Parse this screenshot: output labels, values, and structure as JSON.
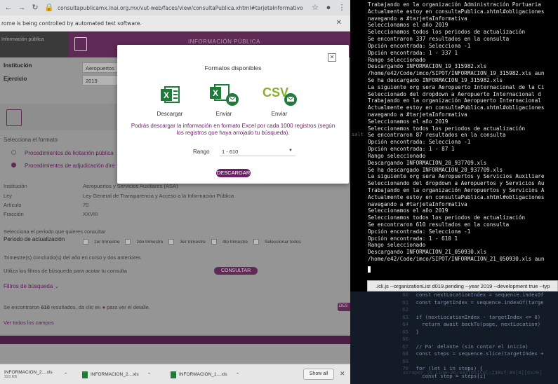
{
  "browser": {
    "url": "consultapublicamx.inai.org.mx/vut-web/faces/view/consultaPublica.xhtml#tarjetaInformativo",
    "automation_banner": "rome is being controlled by automated test software.",
    "header": {
      "logo_alt": "Información pública",
      "title": "INFORMACIÓN PÚBLICA"
    },
    "institucion_label": "Institución",
    "institucion_value": "Aeropuertos",
    "ejercicio_label": "Ejercicio",
    "ejercicio_value": "2019",
    "select_format_label": "Selecciona el formato",
    "radio_options": [
      "Procedimientos de licitación pública",
      "Procedimientos de adjudicación dire"
    ],
    "info_rows": [
      {
        "label": "Institución",
        "value": "Aeropuertos y Servicios Auxiliares (ASA)"
      },
      {
        "label": "Ley",
        "value": "Ley General de Transparencia y Acceso a la Información Pública"
      },
      {
        "label": "Artículo",
        "value": "70"
      },
      {
        "label": "Fracción",
        "value": "XXVIII"
      }
    ],
    "period_prompt": "Selecciona el periodo que quieres consultar",
    "period_label": "Periodo de actualización",
    "periods": [
      "1er trimestre",
      "2do trimestre",
      "3er trimestre",
      "4to trimestre",
      "Seleccionar todos"
    ],
    "trimestre_note": "Trimestre(s) concluido(s) del año en curso y dos anteriores",
    "filtros_prompt": "Utiliza los filtros de búsqueda para acotar tu consulta",
    "consultar_button": "CONSULTAR",
    "filtros_link": "Filtros de búsqueda",
    "results_prefix": "Se encontraron",
    "results_count": "610",
    "results_suffix": "resultados, da clic en",
    "results_tail": "para ver el detalle.",
    "ver_todos": "Ver todos los campos",
    "side_tab": "DES"
  },
  "modal": {
    "title": "Formatos disponibles",
    "close_icon": "close-icon",
    "formats": [
      {
        "label": "Descargar",
        "icon": "excel-icon"
      },
      {
        "label": "Enviar",
        "icon": "excel-mail-icon"
      },
      {
        "label": "Enviar",
        "icon": "csv-mail-icon"
      }
    ],
    "note": "Podrás descargar la información en formato Excel por cada 1000 registros (según los registros que haya arrojado tu búsqueda).",
    "rango_label": "Rango",
    "rango_value": "1 - 610",
    "download_button": "DESCARGAR",
    "colors": {
      "excel": "#1e7b3a",
      "csv": "#8ab02a",
      "accent": "#6a1f67"
    }
  },
  "downloads": [
    {
      "name": "INFORMACION_2....xls",
      "size": "323 KB"
    },
    {
      "name": "INFORMACION_2....xls",
      "size": ""
    },
    {
      "name": "INFORMACION_1....xls",
      "size": ""
    }
  ],
  "downloads_show_all": "Show all",
  "terminal": {
    "lines": [
      "Trabajando en la organización Administración Portuaria",
      "Actualmente estoy en consultaPublica.xhtml#obligaciones",
      "navegando a #tarjetaInformativa",
      "Seleccionamos el año 2019",
      "Seleccionamos todos los periodos de actualización",
      "Se encontraron 337 resultados en la consulta",
      "Opción encontrada: Selecciona -1",
      "Opción encontrada: 1 - 337 1",
      "Rango seleccionado",
      "Descargando INFORMACION_19_315982.xls",
      "/home/e42/Code/imco/SIPOT/INFORMACION_19_315982.xls aun",
      "Se ha descargado INFORMACION_19_315982.xls",
      "La siguiente org sera Aeropuerto Internacional de la Ci",
      "Seleccionado del dropdown a Aeropuerto Internacional d",
      "Trabajando en la organización Aeropuerto Internacional",
      "Actualmente estoy en consultaPublica.xhtml#obligaciones",
      "navegando a #tarjetaInformativa",
      "Seleccionamos el año 2019",
      "Seleccionamos todos los periodos de actualización",
      "Se encontraron 87 resultados en la consulta",
      "Opción encontrada: Selecciona -1",
      "Opción encontrada: 1 - 87 1",
      "Rango seleccionado",
      "Descargando INFORMACION_20_937709.xls",
      "Se ha descargado INFORMACION_20_937709.xls",
      "La siguiente org sera Aeropuertos y Servicios Auxiliare",
      "Seleccionando del dropdown a Aeropuertos y Servicios Au",
      "Trabajando en la organización Aeropuertos y Servicios A",
      "Actualmente estoy en consultaPublica.xhtml#obligaciones",
      "navegando a #tarjetaInformativa",
      "Seleccionamos el año 2019",
      "Seleccionamos todos los periodos de actualización",
      "Se encontraron 610 resultados en la consulta",
      "Opción encontrada: Selecciona -1",
      "Opción encontrada: 1 - 610 1",
      "Rango seleccionado",
      "Descargando INFORMACION_21_050930.xls",
      "/home/e42/Code/imco/SIPOT/INFORMACION_21_050930.xls aun"
    ],
    "side_label": "salt",
    "command_tip": "./cli.js --organizationList d019.pending --year 2019 --development true --typ"
  },
  "editor": {
    "gutter": [
      "60",
      "61",
      "62",
      "63",
      "64",
      "65",
      "66",
      "67",
      "68",
      "69",
      "70"
    ],
    "code": [
      "  const nextLocationIndex = sequence.indexOf",
      "  const targetIndex = sequence.indexOf(targe",
      "",
      "  if (nextLocationIndex - targetIndex <= 0)",
      "    return await backTo(page, nextLocation)",
      "  }",
      "",
      "  // Pa' delante (sin contar el inicio)",
      "  const steps = sequence.slice(targetIndex +",
      "",
      "  for (let i in steps) {",
      "    const step = steps[i]"
    ],
    "status": "scraper.js  Line:26/433[6%]Col:24Buf:#4[4][0x29]"
  }
}
